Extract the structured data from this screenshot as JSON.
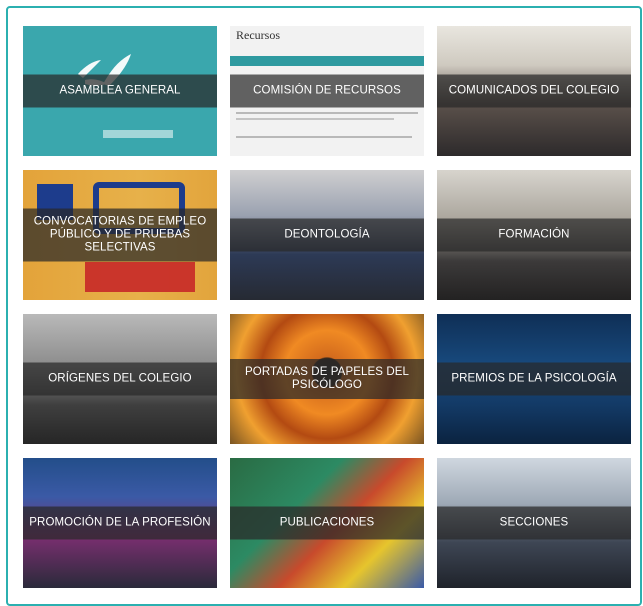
{
  "tiles": [
    {
      "label": "ASAMBLEA GENERAL",
      "icon": "logo-icon"
    },
    {
      "label": "COMISIÓN DE RECURSOS",
      "doc_title": "Recursos"
    },
    {
      "label": "COMUNICADOS DEL COLEGIO"
    },
    {
      "label": "CONVOCATORIAS DE EMPLEO PÚBLICO Y DE PRUEBAS SELECTIVAS"
    },
    {
      "label": "DEONTOLOGÍA"
    },
    {
      "label": "FORMACIÓN"
    },
    {
      "label": "ORÍGENES DEL COLEGIO"
    },
    {
      "label": "PORTADAS DE PAPELES DEL PSICÓLOGO"
    },
    {
      "label": "PREMIOS DE LA PSICOLOGÍA"
    },
    {
      "label": "PROMOCIÓN DE LA PROFESIÓN"
    },
    {
      "label": "PUBLICACIONES"
    },
    {
      "label": "SECCIONES"
    }
  ],
  "colors": {
    "frame_border": "#2bb0b0",
    "label_bg": "rgba(40,40,40,0.72)",
    "label_text": "#ffffff"
  }
}
